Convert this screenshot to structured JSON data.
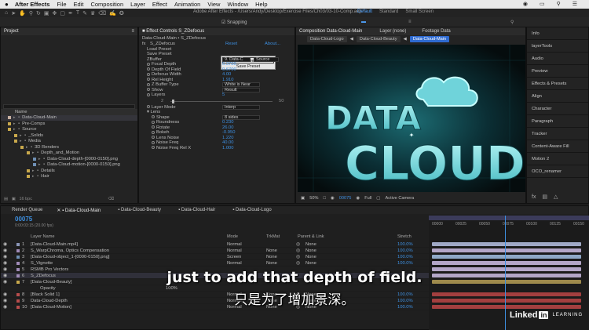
{
  "menubar": {
    "apple": "",
    "items": [
      "After Effects",
      "File",
      "Edit",
      "Composition",
      "Layer",
      "Effect",
      "Animation",
      "View",
      "Window",
      "Help"
    ]
  },
  "toolbar": {
    "title": "Adobe After Effects - /Users/Andy/Desktop/Exercise Files/Ch03/03-10-Comp.aep *",
    "snapping": "Snapping",
    "workspaces": [
      "Default",
      "Standard",
      "Small Screen"
    ]
  },
  "project": {
    "tab": "Project",
    "column": "Name",
    "items": [
      {
        "label": "Data-Cloud-Main",
        "color": "#c9b1a1",
        "indent": 0
      },
      {
        "label": "Pre-Comps",
        "color": "#c9a94c",
        "indent": 0
      },
      {
        "label": "Source",
        "color": "#c9a94c",
        "indent": 0
      },
      {
        "label": "_Solids",
        "color": "#c9a94c",
        "indent": 1
      },
      {
        "label": "Media",
        "color": "#c9a94c",
        "indent": 1
      },
      {
        "label": "3D Renders",
        "color": "#c9a94c",
        "indent": 2
      },
      {
        "label": "Depth_and_Motion",
        "color": "#c9a94c",
        "indent": 3
      },
      {
        "label": "Data-Cloud-depth-[0000-0150].png",
        "color": "#6e8fb4",
        "indent": 4
      },
      {
        "label": "Data-Cloud-motion-[0000-0150].png",
        "color": "#6e8fb4",
        "indent": 4
      },
      {
        "label": "Details",
        "color": "#c9a94c",
        "indent": 3
      },
      {
        "label": "Hair",
        "color": "#c9a94c",
        "indent": 3
      }
    ],
    "footer": "16 bpc"
  },
  "effect_controls": {
    "tab": "Effect Controls S_ZDefocus",
    "breadcrumb": "Data-Cloud-Main • S_ZDefocus",
    "effect": "S_ZDefocus",
    "reset": "Reset",
    "about": "About...",
    "load_preset": "Load Preset",
    "save_preset": "Save Preset",
    "popup_load": "Load Preset",
    "popup_save": "Save Preset",
    "zbuffer_label": "ZBuffer",
    "zbuffer_value": "9. Data-C",
    "zbuffer_source": "Source",
    "params": [
      {
        "label": "Focal Depth",
        "value": "0.3700"
      },
      {
        "label": "Depth Of Field",
        "value": "0.6700"
      },
      {
        "label": "Defocus Width",
        "value": "4.00"
      },
      {
        "label": "Rel Height",
        "value": "1.910"
      },
      {
        "label": "Z Buffer Type",
        "value": "White is Near"
      },
      {
        "label": "Show",
        "value": "Result"
      },
      {
        "label": "Layers",
        "value": "5"
      }
    ],
    "slider_min": "2",
    "slider_max": "50",
    "layer_mode_label": "Layer Mode",
    "layer_mode_value": "Interp",
    "lens_label": "Lens",
    "lens_params": [
      {
        "label": "Shape",
        "value": "8 sides"
      },
      {
        "label": "Roundness",
        "value": "0.230"
      },
      {
        "label": "Rotate",
        "value": "26.00"
      },
      {
        "label": "Bokeh",
        "value": "-0.950"
      },
      {
        "label": "Lens Noise",
        "value": "1.220"
      },
      {
        "label": "Noise Freq",
        "value": "40.00"
      },
      {
        "label": "Noise Freq Rel X",
        "value": "1.000"
      }
    ]
  },
  "composition": {
    "tabs": [
      "Composition Data-Cloud-Main",
      "Layer (none)",
      "Footage Data"
    ],
    "flow": [
      "Data-Cloud-Logo",
      "Data-Cloud-Beauty",
      "Data-Cloud-Main"
    ],
    "logo_line1": "DATA",
    "logo_line2": "CLOUD",
    "zoom": "50%",
    "timecode": "00075",
    "resolution": "Full",
    "camera": "Active Camera"
  },
  "right_panel": [
    "Info",
    "layerTools",
    "Audio",
    "Preview",
    "Effects & Presets",
    "Align",
    "Character",
    "Paragraph",
    "Tracker",
    "Content-Aware Fill",
    "Motion 2",
    "OCO_renamer"
  ],
  "timeline": {
    "tabs": [
      "Render Queue",
      "Data-Cloud-Main",
      "Data-Cloud-Beauty",
      "Data-Cloud-Hair",
      "Data-Cloud-Logo"
    ],
    "timecode": "00075",
    "timecode_sub": "0:00:03:15 (20.00 fps)",
    "columns": {
      "layer": "Layer Name",
      "mode": "Mode",
      "trkmat": "TrkMat",
      "parent": "Parent & Link",
      "stretch": "Stretch"
    },
    "ruler": [
      "00000",
      "00025",
      "00050",
      "00075",
      "00100",
      "00125",
      "00150"
    ],
    "layers": [
      {
        "num": "1",
        "name": "[Data-Cloud-Main.mp4]",
        "mode": "Normal",
        "trkmat": "",
        "parent": "None",
        "stretch": "100.0%",
        "color": "#8b96b8",
        "bar": "#a0a9c6"
      },
      {
        "num": "2",
        "name": "S_WarpChroma, Optics Compensation",
        "mode": "Normal",
        "trkmat": "None",
        "parent": "None",
        "stretch": "100.0%",
        "color": "#a08bb8",
        "bar": "#b3a6c7"
      },
      {
        "num": "3",
        "name": "[Data-Cloud-object_1-[0000-0150].png]",
        "mode": "Screen",
        "trkmat": "None",
        "parent": "None",
        "stretch": "100.0%",
        "color": "#6e8fb4",
        "bar": "#8fa8c6"
      },
      {
        "num": "4",
        "name": "S_Vignette",
        "mode": "Normal",
        "trkmat": "None",
        "parent": "None",
        "stretch": "100.0%",
        "color": "#a08bb8",
        "bar": "#b3a6c7"
      },
      {
        "num": "5",
        "name": "RSMB Pro Vectors",
        "mode": "",
        "trkmat": "",
        "parent": "",
        "stretch": "",
        "color": "#a08bb8",
        "bar": "#b3a6c7"
      },
      {
        "num": "6",
        "name": "S_ZDefocus",
        "mode": "",
        "trkmat": "",
        "parent": "",
        "stretch": "",
        "color": "#a08bb8",
        "bar": "#b3a6c7"
      },
      {
        "num": "7",
        "name": "[Data-Cloud-Beauty]",
        "mode": "",
        "trkmat": "",
        "parent": "",
        "stretch": "",
        "color": "#c9a94c",
        "bar": "#9e8a4c"
      },
      {
        "num": "",
        "name": "Opacity",
        "mode": "100%",
        "trkmat": "",
        "parent": "",
        "stretch": "",
        "color": "",
        "bar": ""
      },
      {
        "num": "8",
        "name": "[Black Solid 1]",
        "mode": "Normal",
        "trkmat": "None",
        "parent": "None",
        "stretch": "100.0%",
        "color": "#b84c4c",
        "bar": "#a33f3f"
      },
      {
        "num": "9",
        "name": "Data-Cloud-Depth",
        "mode": "Normal",
        "trkmat": "None",
        "parent": "None",
        "stretch": "100.0%",
        "color": "#b84c4c",
        "bar": "#a33f3f"
      },
      {
        "num": "10",
        "name": "[Data-Cloud-Motion]",
        "mode": "Normal",
        "trkmat": "None",
        "parent": "None",
        "stretch": "100.0%",
        "color": "#b84c4c",
        "bar": "#a33f3f"
      }
    ]
  },
  "caption": {
    "en": "just to add that depth of field.",
    "zh": "只是为了增加景深。"
  },
  "watermark": {
    "brand": "Linked",
    "in": "in",
    "learning": "LEARNING"
  }
}
